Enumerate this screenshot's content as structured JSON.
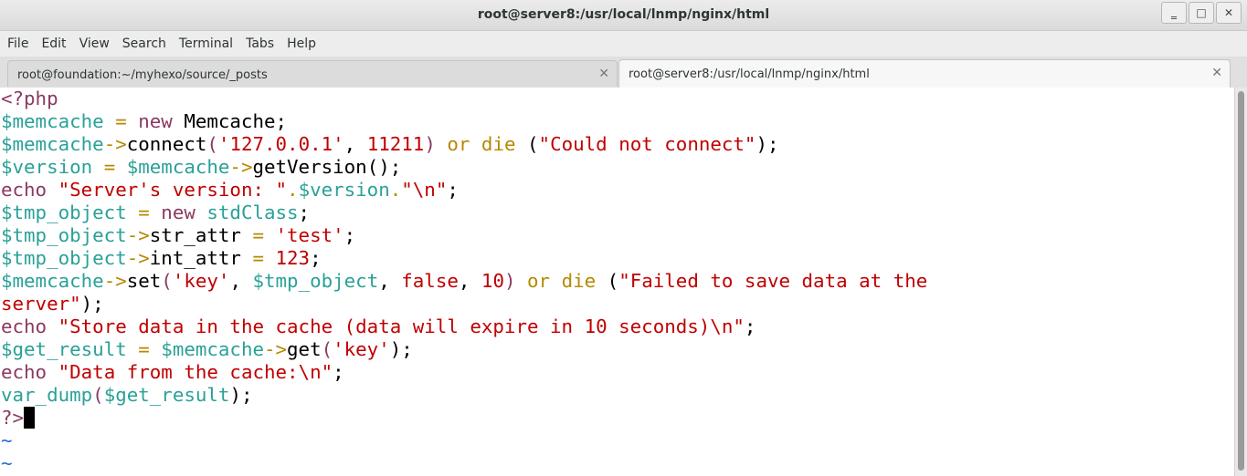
{
  "window": {
    "title": "root@server8:/usr/local/lnmp/nginx/html",
    "buttons": {
      "minimize": "‗",
      "maximize": "□",
      "close": "✕"
    }
  },
  "menu": [
    "File",
    "Edit",
    "View",
    "Search",
    "Terminal",
    "Tabs",
    "Help"
  ],
  "tabs": [
    {
      "label": "root@foundation:~/myhexo/source/_posts",
      "close": "✕",
      "active": false
    },
    {
      "label": "root@server8:/usr/local/lnmp/nginx/html",
      "close": "✕",
      "active": true
    }
  ],
  "colors": {
    "var": "#2aa198",
    "keyword": "#8b3a62",
    "string": "#c00000",
    "number": "#c00000",
    "operator": "#b58900",
    "plain": "#000000",
    "comment": "#8b3a62",
    "tilde": "#2a66d4"
  },
  "code_lines": [
    [
      [
        "<?php",
        "comment"
      ]
    ],
    [
      [
        "$memcache",
        "var"
      ],
      [
        " = ",
        "operator"
      ],
      [
        "new",
        "keyword"
      ],
      [
        " Memcache;",
        "plain"
      ]
    ],
    [
      [
        "$memcache",
        "var"
      ],
      [
        "->",
        "operator"
      ],
      [
        "connect",
        "plain"
      ],
      [
        "(",
        "keyword"
      ],
      [
        "'127.0.0.1'",
        "string"
      ],
      [
        ", ",
        "plain"
      ],
      [
        "11211",
        "number"
      ],
      [
        ")",
        "keyword"
      ],
      [
        " or die",
        "operator"
      ],
      [
        " (",
        "plain"
      ],
      [
        "\"Could not connect\"",
        "string"
      ],
      [
        ");",
        "plain"
      ]
    ],
    [
      [
        "$version",
        "var"
      ],
      [
        " = ",
        "operator"
      ],
      [
        "$memcache",
        "var"
      ],
      [
        "->",
        "operator"
      ],
      [
        "getVersion",
        "plain"
      ],
      [
        "();",
        "plain"
      ]
    ],
    [
      [
        "echo",
        "keyword"
      ],
      [
        " \"Server's version: \"",
        "string"
      ],
      [
        ".",
        "operator"
      ],
      [
        "$version",
        "var"
      ],
      [
        ".",
        "operator"
      ],
      [
        "\"\\n\"",
        "string"
      ],
      [
        ";",
        "plain"
      ]
    ],
    [
      [
        "$tmp_object",
        "var"
      ],
      [
        " = ",
        "operator"
      ],
      [
        "new",
        "keyword"
      ],
      [
        " stdClass",
        "var"
      ],
      [
        ";",
        "plain"
      ]
    ],
    [
      [
        "$tmp_object",
        "var"
      ],
      [
        "->",
        "operator"
      ],
      [
        "str_attr",
        "plain"
      ],
      [
        " = ",
        "operator"
      ],
      [
        "'test'",
        "string"
      ],
      [
        ";",
        "plain"
      ]
    ],
    [
      [
        "$tmp_object",
        "var"
      ],
      [
        "->",
        "operator"
      ],
      [
        "int_attr",
        "plain"
      ],
      [
        " = ",
        "operator"
      ],
      [
        "123",
        "number"
      ],
      [
        ";",
        "plain"
      ]
    ],
    [
      [
        "$memcache",
        "var"
      ],
      [
        "->",
        "operator"
      ],
      [
        "set",
        "plain"
      ],
      [
        "(",
        "keyword"
      ],
      [
        "'key'",
        "string"
      ],
      [
        ", ",
        "plain"
      ],
      [
        "$tmp_object",
        "var"
      ],
      [
        ", ",
        "plain"
      ],
      [
        "false",
        "string"
      ],
      [
        ", ",
        "plain"
      ],
      [
        "10",
        "number"
      ],
      [
        ")",
        "keyword"
      ],
      [
        " or die",
        "operator"
      ],
      [
        " (",
        "plain"
      ],
      [
        "\"Failed to save data at the",
        "string"
      ]
    ],
    [
      [
        "server\"",
        "string"
      ],
      [
        ");",
        "plain"
      ]
    ],
    [
      [
        "echo",
        "keyword"
      ],
      [
        " \"Store data in the cache (data will expire in 10 seconds)\\n\"",
        "string"
      ],
      [
        ";",
        "plain"
      ]
    ],
    [
      [
        "$get_result",
        "var"
      ],
      [
        " = ",
        "operator"
      ],
      [
        "$memcache",
        "var"
      ],
      [
        "->",
        "operator"
      ],
      [
        "get",
        "plain"
      ],
      [
        "(",
        "keyword"
      ],
      [
        "'key'",
        "string"
      ],
      [
        ");",
        "plain"
      ]
    ],
    [
      [
        "echo",
        "keyword"
      ],
      [
        " \"Data from the cache:\\n\"",
        "string"
      ],
      [
        ";",
        "plain"
      ]
    ],
    [
      [
        "var_dump",
        "var"
      ],
      [
        "(",
        "keyword"
      ],
      [
        "$get_result",
        "var"
      ],
      [
        ");",
        "plain"
      ]
    ],
    [
      [
        "?>",
        "comment"
      ]
    ],
    [
      [
        "~",
        "tilde"
      ]
    ],
    [
      [
        "~",
        "tilde"
      ]
    ]
  ]
}
